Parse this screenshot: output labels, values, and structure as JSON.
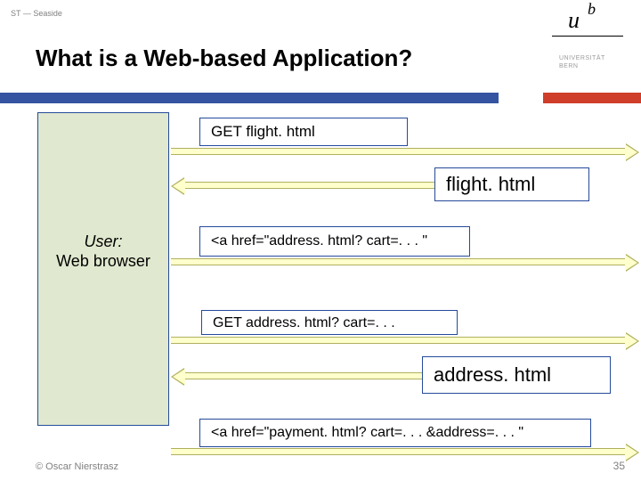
{
  "header": {
    "course_tag": "ST — Seaside",
    "title": "What is a Web-based Application?"
  },
  "uni_logo": {
    "u": "u",
    "b": "b",
    "line1": "UNIVERSITÄT",
    "line2": "BERN"
  },
  "user_box": {
    "line1": "User:",
    "line2": "Web browser"
  },
  "messages": {
    "m1": "GET flight. html",
    "m2": "flight. html",
    "m3": "<a href=\"address. html? cart=. . . \"",
    "m4": "GET address. html? cart=. . .",
    "m5": "address. html",
    "m6": "<a href=\"payment. html? cart=. . . &address=. . . \""
  },
  "footer": {
    "copyright": "© Oscar Nierstrasz",
    "page": "35"
  }
}
